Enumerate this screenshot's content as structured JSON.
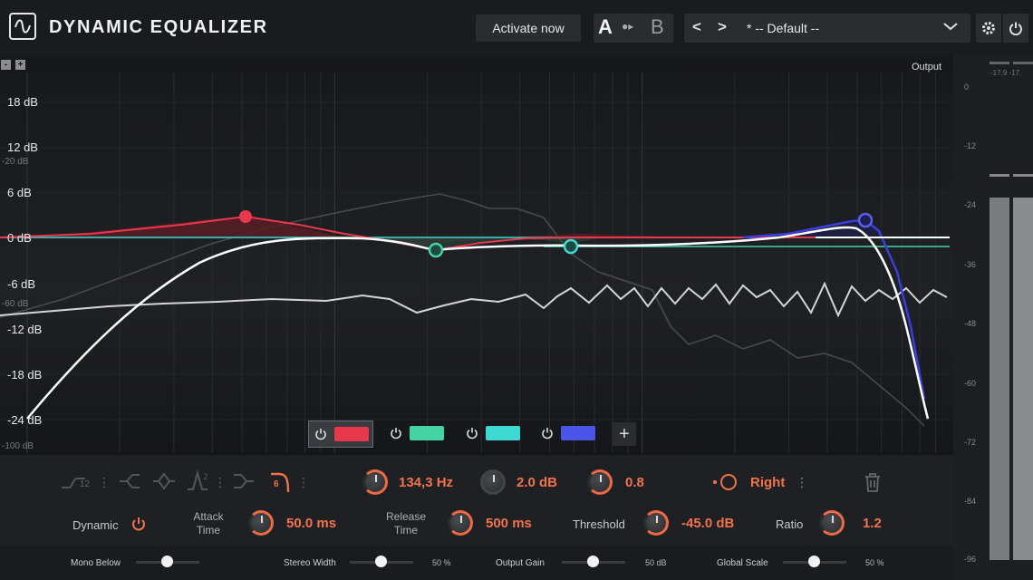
{
  "header": {
    "title": "DYNAMIC EQUALIZER",
    "activate_label": "Activate now",
    "ab_a": "A",
    "ab_arrow": "●▸",
    "ab_b": "B",
    "prev": "<",
    "next": ">",
    "preset": "* -- Default --",
    "icons": [
      "logo-icon",
      "chevron-down-icon",
      "gear-icon",
      "power-icon"
    ]
  },
  "graph": {
    "zoom_minus": "-",
    "zoom_plus": "+",
    "output_label": "Output",
    "db_labels": [
      "18 dB",
      "12 dB",
      "6 dB",
      "0 dB",
      "-6 dB",
      "-12 dB",
      "-18 dB",
      "-24 dB"
    ],
    "small_labels": [
      "-20 dB",
      "-60 dB",
      "-100 dB"
    ],
    "colors": {
      "red": "#e8394c",
      "green": "#45d3a4",
      "cyan": "#3fd8d2",
      "blue": "#3b3fe0"
    }
  },
  "bands": {
    "add_label": "+",
    "items": [
      {
        "color": "#e8394c"
      },
      {
        "color": "#45d3a4"
      },
      {
        "color": "#3fd8d2"
      },
      {
        "color": "#4c55e8"
      }
    ]
  },
  "meter": {
    "top_readout": "-17.9 -17.",
    "scale": [
      "0",
      "-12",
      "-24",
      "-36",
      "-48",
      "-60",
      "-72",
      "-84",
      "-96"
    ]
  },
  "controls": {
    "slope_value": "12",
    "order_value": "6",
    "frequency": "134,3 Hz",
    "gain": "2.0 dB",
    "q": "0.8",
    "channel": "Right",
    "dynamic_label": "Dynamic",
    "attack_label": "Attack Time",
    "attack_value": "50.0 ms",
    "release_label": "Release Time",
    "release_value": "500 ms",
    "threshold_label": "Threshold",
    "threshold_value": "-45.0 dB",
    "ratio_label": "Ratio",
    "ratio_value": "1.2",
    "accent": "#f0734a"
  },
  "bottom": {
    "mono_below": "Mono Below",
    "stereo_width": "Stereo Width",
    "stereo_width_value": "50 %",
    "stereo_width_level": 0.5,
    "output_gain": "Output Gain",
    "output_gain_value": "50 dB",
    "global_scale": "Global Scale",
    "global_scale_value": "50 %",
    "global_scale_level": 0.5
  }
}
